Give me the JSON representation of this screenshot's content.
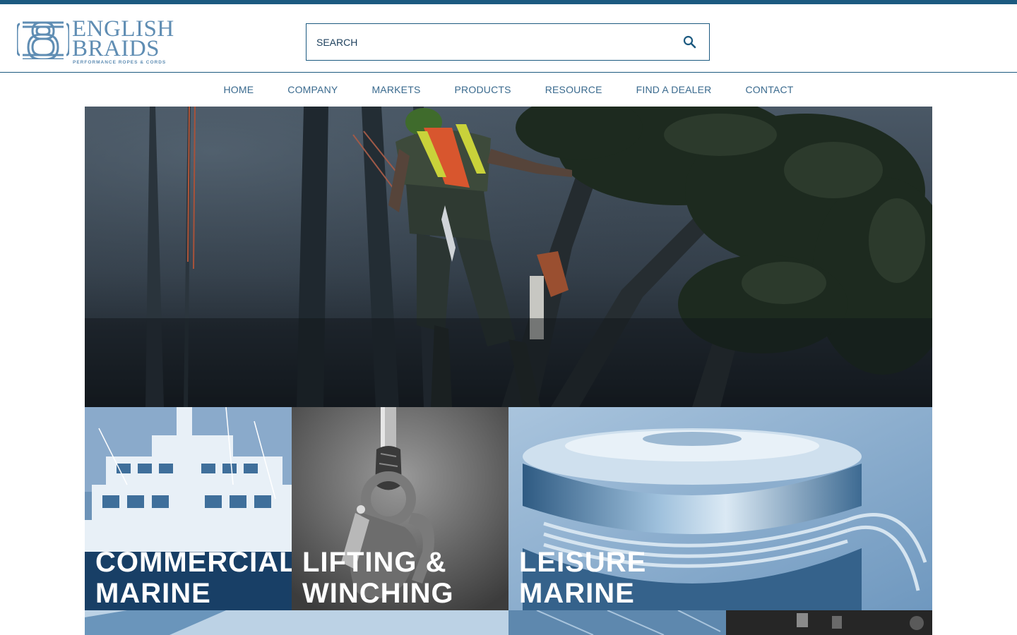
{
  "brand": {
    "name_line1": "ENGLISH",
    "name_line2": "BRAIDS",
    "tagline": "PERFORMANCE ROPES & CORDS",
    "color": "#1c5a80"
  },
  "search": {
    "placeholder": "SEARCH",
    "icon": "search-icon"
  },
  "nav": {
    "items": [
      {
        "label": "HOME"
      },
      {
        "label": "COMPANY"
      },
      {
        "label": "MARKETS"
      },
      {
        "label": "PRODUCTS"
      },
      {
        "label": "RESOURCE"
      },
      {
        "label": "FIND A DEALER"
      },
      {
        "label": "CONTACT"
      }
    ]
  },
  "tiles": [
    {
      "line1": "COMMERCIAL",
      "line2": "MARINE"
    },
    {
      "line1": "LIFTING &",
      "line2": "WINCHING"
    },
    {
      "line1": "LEISURE",
      "line2": "MARINE"
    }
  ]
}
